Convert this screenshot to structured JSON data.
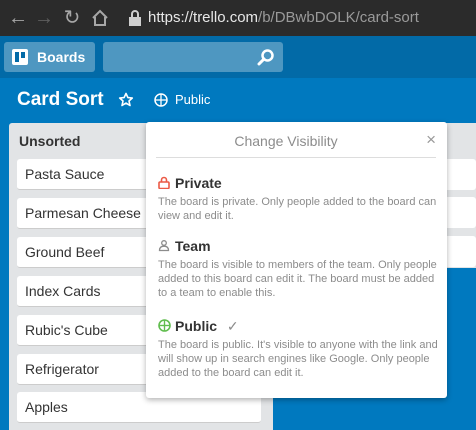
{
  "browser": {
    "url_host": "https://trello.com",
    "url_path": "/b/DBwbDOLK/card-sort"
  },
  "header": {
    "boards_label": "Boards",
    "search_placeholder": ""
  },
  "board": {
    "title": "Card Sort",
    "visibility_label": "Public"
  },
  "list": {
    "title": "Unsorted",
    "cards": [
      "Pasta Sauce",
      "Parmesan Cheese",
      "Ground Beef",
      "Index Cards",
      "Rubic's Cube",
      "Refrigerator",
      "Apples"
    ]
  },
  "popover": {
    "title": "Change Visibility",
    "close": "×",
    "options": [
      {
        "label": "Private",
        "desc": "The board is private. Only people added to the board can view and edit it.",
        "selected": false
      },
      {
        "label": "Team",
        "desc": "The board is visible to members of the team. Only people added to this board can edit it. The board must be added to a team to enable this.",
        "selected": false
      },
      {
        "label": "Public",
        "desc": "The board is public. It's visible to anyone with the link and will show up in search engines like Google. Only people added to the board can edit it.",
        "selected": true
      }
    ],
    "check": "✓"
  },
  "colors": {
    "board_bg": "#0079bf",
    "header_bg": "#026aa7",
    "private_icon": "#eb5a46",
    "public_icon": "#61bd4f"
  }
}
